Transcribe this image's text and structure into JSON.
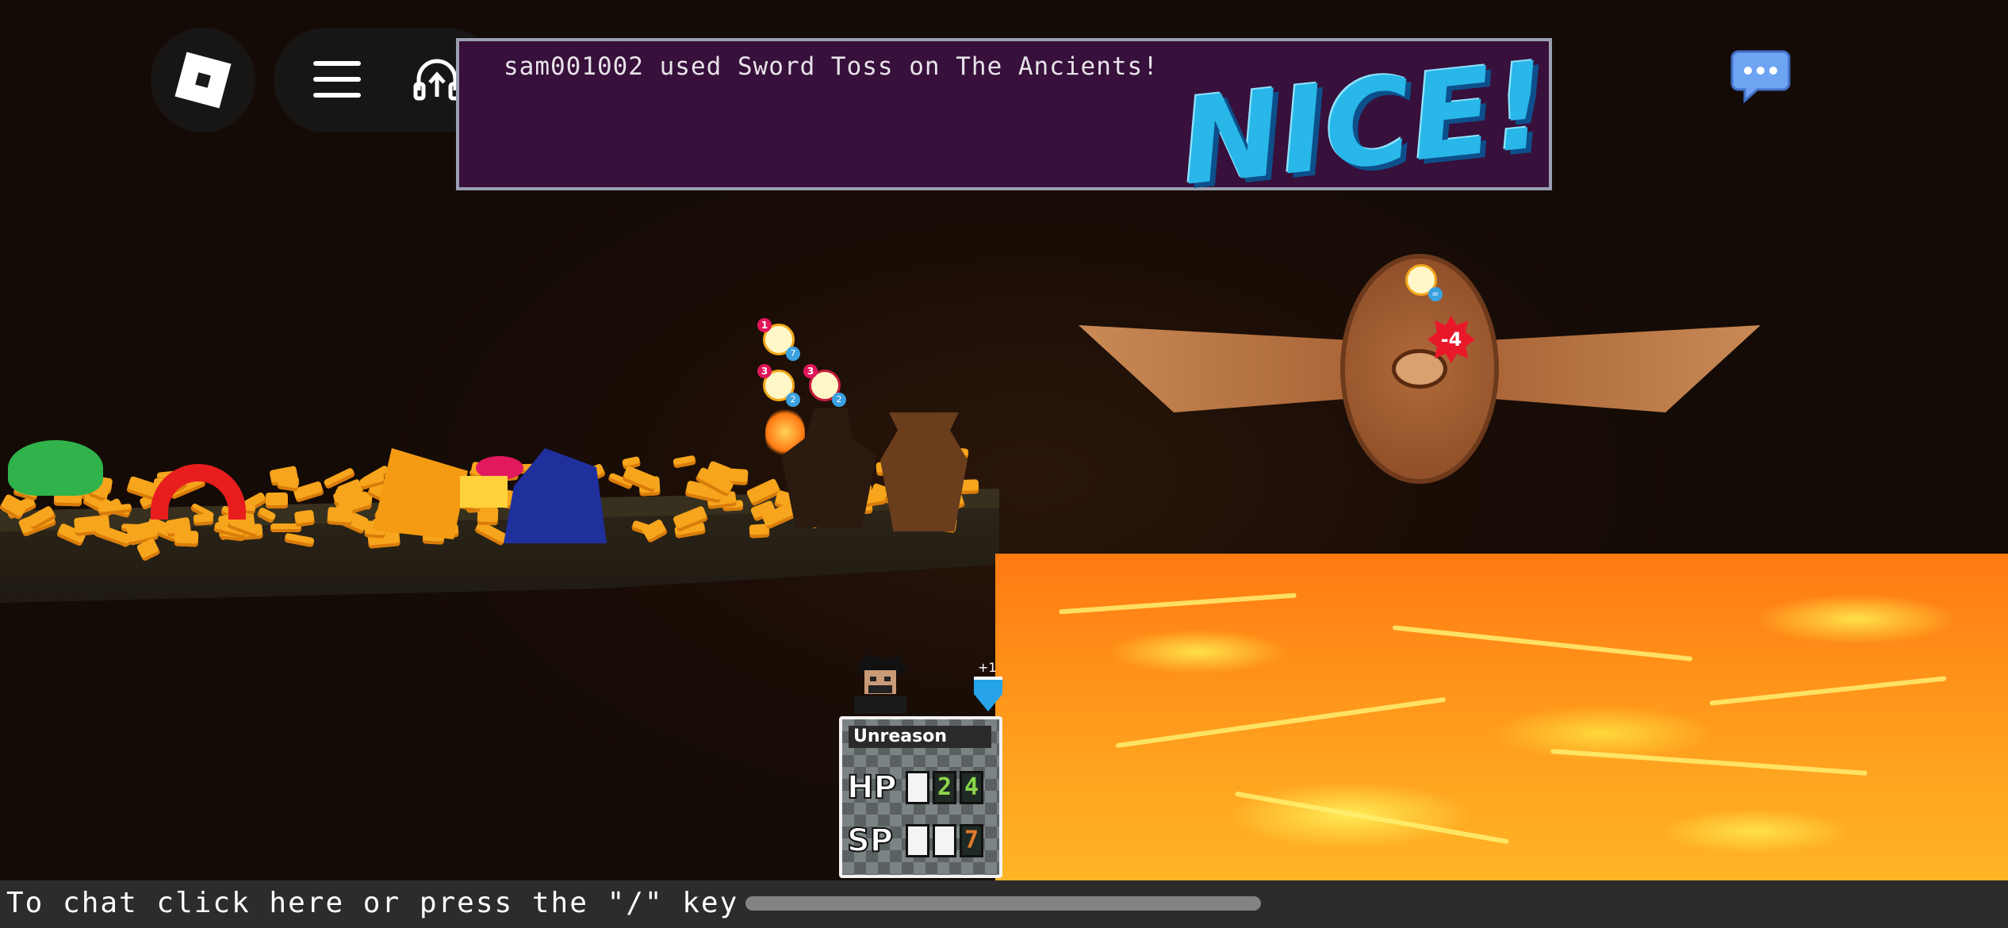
{
  "hud": {
    "roblox_icon": "roblox-logo-icon",
    "menu_icon": "hamburger-menu-icon",
    "headset_icon": "headset-upload-icon",
    "chat_icon": "chat-bubble-icon"
  },
  "banner": {
    "message": "sam001002 used Sword Toss on The Ancients!",
    "feedback": "NICE!"
  },
  "boss": {
    "damage_popup": "-4"
  },
  "player_card": {
    "name": "Unreason",
    "hp_label": "HP",
    "hp_digits": [
      "",
      "2",
      "4"
    ],
    "sp_label": "SP",
    "sp_digits": [
      "",
      "",
      "7"
    ],
    "shield_label": "+1"
  },
  "chat": {
    "prompt": "To chat click here or press the \"/\" key"
  },
  "colors": {
    "banner_bg": "#37103b",
    "nice": "#29b6e8",
    "lava": "#ff8a18",
    "damage": "#e8182a"
  }
}
